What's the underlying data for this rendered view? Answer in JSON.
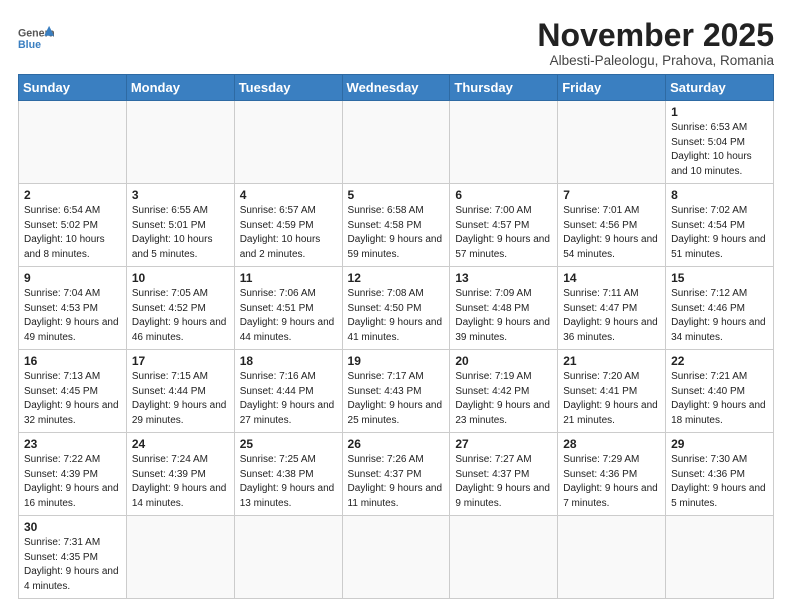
{
  "header": {
    "logo_general": "General",
    "logo_blue": "Blue",
    "month_title": "November 2025",
    "subtitle": "Albesti-Paleologu, Prahova, Romania"
  },
  "days_of_week": [
    "Sunday",
    "Monday",
    "Tuesday",
    "Wednesday",
    "Thursday",
    "Friday",
    "Saturday"
  ],
  "weeks": [
    [
      {
        "day": "",
        "info": ""
      },
      {
        "day": "",
        "info": ""
      },
      {
        "day": "",
        "info": ""
      },
      {
        "day": "",
        "info": ""
      },
      {
        "day": "",
        "info": ""
      },
      {
        "day": "",
        "info": ""
      },
      {
        "day": "1",
        "info": "Sunrise: 6:53 AM\nSunset: 5:04 PM\nDaylight: 10 hours and 10 minutes."
      }
    ],
    [
      {
        "day": "2",
        "info": "Sunrise: 6:54 AM\nSunset: 5:02 PM\nDaylight: 10 hours and 8 minutes."
      },
      {
        "day": "3",
        "info": "Sunrise: 6:55 AM\nSunset: 5:01 PM\nDaylight: 10 hours and 5 minutes."
      },
      {
        "day": "4",
        "info": "Sunrise: 6:57 AM\nSunset: 4:59 PM\nDaylight: 10 hours and 2 minutes."
      },
      {
        "day": "5",
        "info": "Sunrise: 6:58 AM\nSunset: 4:58 PM\nDaylight: 9 hours and 59 minutes."
      },
      {
        "day": "6",
        "info": "Sunrise: 7:00 AM\nSunset: 4:57 PM\nDaylight: 9 hours and 57 minutes."
      },
      {
        "day": "7",
        "info": "Sunrise: 7:01 AM\nSunset: 4:56 PM\nDaylight: 9 hours and 54 minutes."
      },
      {
        "day": "8",
        "info": "Sunrise: 7:02 AM\nSunset: 4:54 PM\nDaylight: 9 hours and 51 minutes."
      }
    ],
    [
      {
        "day": "9",
        "info": "Sunrise: 7:04 AM\nSunset: 4:53 PM\nDaylight: 9 hours and 49 minutes."
      },
      {
        "day": "10",
        "info": "Sunrise: 7:05 AM\nSunset: 4:52 PM\nDaylight: 9 hours and 46 minutes."
      },
      {
        "day": "11",
        "info": "Sunrise: 7:06 AM\nSunset: 4:51 PM\nDaylight: 9 hours and 44 minutes."
      },
      {
        "day": "12",
        "info": "Sunrise: 7:08 AM\nSunset: 4:50 PM\nDaylight: 9 hours and 41 minutes."
      },
      {
        "day": "13",
        "info": "Sunrise: 7:09 AM\nSunset: 4:48 PM\nDaylight: 9 hours and 39 minutes."
      },
      {
        "day": "14",
        "info": "Sunrise: 7:11 AM\nSunset: 4:47 PM\nDaylight: 9 hours and 36 minutes."
      },
      {
        "day": "15",
        "info": "Sunrise: 7:12 AM\nSunset: 4:46 PM\nDaylight: 9 hours and 34 minutes."
      }
    ],
    [
      {
        "day": "16",
        "info": "Sunrise: 7:13 AM\nSunset: 4:45 PM\nDaylight: 9 hours and 32 minutes."
      },
      {
        "day": "17",
        "info": "Sunrise: 7:15 AM\nSunset: 4:44 PM\nDaylight: 9 hours and 29 minutes."
      },
      {
        "day": "18",
        "info": "Sunrise: 7:16 AM\nSunset: 4:44 PM\nDaylight: 9 hours and 27 minutes."
      },
      {
        "day": "19",
        "info": "Sunrise: 7:17 AM\nSunset: 4:43 PM\nDaylight: 9 hours and 25 minutes."
      },
      {
        "day": "20",
        "info": "Sunrise: 7:19 AM\nSunset: 4:42 PM\nDaylight: 9 hours and 23 minutes."
      },
      {
        "day": "21",
        "info": "Sunrise: 7:20 AM\nSunset: 4:41 PM\nDaylight: 9 hours and 21 minutes."
      },
      {
        "day": "22",
        "info": "Sunrise: 7:21 AM\nSunset: 4:40 PM\nDaylight: 9 hours and 18 minutes."
      }
    ],
    [
      {
        "day": "23",
        "info": "Sunrise: 7:22 AM\nSunset: 4:39 PM\nDaylight: 9 hours and 16 minutes."
      },
      {
        "day": "24",
        "info": "Sunrise: 7:24 AM\nSunset: 4:39 PM\nDaylight: 9 hours and 14 minutes."
      },
      {
        "day": "25",
        "info": "Sunrise: 7:25 AM\nSunset: 4:38 PM\nDaylight: 9 hours and 13 minutes."
      },
      {
        "day": "26",
        "info": "Sunrise: 7:26 AM\nSunset: 4:37 PM\nDaylight: 9 hours and 11 minutes."
      },
      {
        "day": "27",
        "info": "Sunrise: 7:27 AM\nSunset: 4:37 PM\nDaylight: 9 hours and 9 minutes."
      },
      {
        "day": "28",
        "info": "Sunrise: 7:29 AM\nSunset: 4:36 PM\nDaylight: 9 hours and 7 minutes."
      },
      {
        "day": "29",
        "info": "Sunrise: 7:30 AM\nSunset: 4:36 PM\nDaylight: 9 hours and 5 minutes."
      }
    ],
    [
      {
        "day": "30",
        "info": "Sunrise: 7:31 AM\nSunset: 4:35 PM\nDaylight: 9 hours and 4 minutes."
      },
      {
        "day": "",
        "info": ""
      },
      {
        "day": "",
        "info": ""
      },
      {
        "day": "",
        "info": ""
      },
      {
        "day": "",
        "info": ""
      },
      {
        "day": "",
        "info": ""
      },
      {
        "day": "",
        "info": ""
      }
    ]
  ]
}
